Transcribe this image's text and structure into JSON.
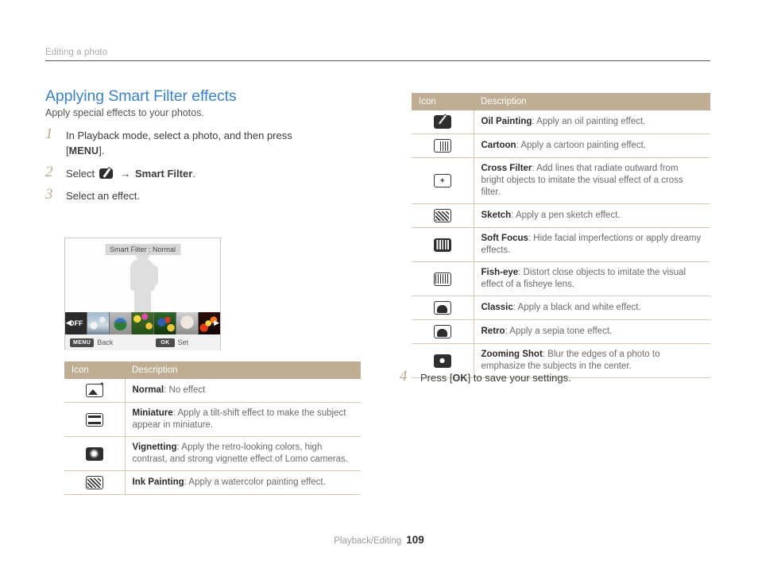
{
  "running_header": {
    "text": "Editing a photo"
  },
  "section": {
    "title": "Applying Smart Filter effects",
    "subtitle": "Apply special effects to your photos."
  },
  "steps": [
    {
      "num": "1",
      "text_before": "In Playback mode, select a photo, and then press",
      "bracket_open": "[",
      "key": "MENU",
      "bracket_close": "].",
      "text_after": ""
    },
    {
      "num": "2",
      "text_before": "Select",
      "icon": "edit-icon",
      "arrow": "→",
      "bold": "Smart Filter",
      "text_after": "."
    },
    {
      "num": "3",
      "text_before": "Select an effect.",
      "text_after": ""
    }
  ],
  "step4": {
    "num": "4",
    "text_before": "Press [",
    "key": "OK",
    "text_after": "] to save your settings."
  },
  "camera_screen": {
    "osd_label": "Smart Filter : Normal",
    "thumbnails": [
      {
        "label": "OFF",
        "kind": "off"
      },
      {
        "label": "",
        "kind": "sky"
      },
      {
        "label": "",
        "kind": "globe"
      },
      {
        "label": "",
        "kind": "flowers"
      },
      {
        "label": "",
        "kind": "parrot"
      },
      {
        "label": "",
        "kind": "face"
      },
      {
        "label": "",
        "kind": "fire"
      }
    ],
    "arrow_left": "◀",
    "arrow_right": "▶",
    "bottom_left_button": "MENU",
    "bottom_left_label": "Back",
    "bottom_right_button": "OK",
    "bottom_right_label": "Set"
  },
  "table_left": {
    "headers": {
      "icon": "Icon",
      "description": "Description"
    },
    "rows": [
      {
        "icon": "normal-icon",
        "name": "Normal",
        "desc": ": No effect"
      },
      {
        "icon": "miniature-icon",
        "name": "Miniature",
        "desc": ": Apply a tilt-shift effect to make the subject appear in miniature."
      },
      {
        "icon": "vignetting-icon",
        "name": "Vignetting",
        "desc": ": Apply the retro-looking colors, high contrast, and strong vignette effect of Lomo cameras."
      },
      {
        "icon": "ink-painting-icon",
        "name": "Ink Painting",
        "desc": ": Apply a watercolor painting effect."
      }
    ]
  },
  "table_right": {
    "headers": {
      "icon": "Icon",
      "description": "Description"
    },
    "rows": [
      {
        "icon": "oil-painting-icon",
        "name": "Oil Painting",
        "desc": ": Apply an oil painting effect."
      },
      {
        "icon": "cartoon-icon",
        "name": "Cartoon",
        "desc": ": Apply a cartoon painting effect."
      },
      {
        "icon": "cross-filter-icon",
        "name": "Cross Filter",
        "desc": ": Add lines that radiate outward from bright objects to imitate the visual effect of a cross filter."
      },
      {
        "icon": "sketch-icon",
        "name": "Sketch",
        "desc": ": Apply a pen sketch effect."
      },
      {
        "icon": "soft-focus-icon",
        "name": "Soft Focus",
        "desc": ": Hide facial imperfections or apply dreamy effects."
      },
      {
        "icon": "fish-eye-icon",
        "name": "Fish-eye",
        "desc": ": Distort close objects to imitate the visual effect of a fisheye lens."
      },
      {
        "icon": "classic-icon",
        "name": "Classic",
        "desc": ": Apply a black and white effect."
      },
      {
        "icon": "retro-icon",
        "name": "Retro",
        "desc": ": Apply a sepia tone effect."
      },
      {
        "icon": "zooming-shot-icon",
        "name": "Zooming Shot",
        "desc": ": Blur the edges of a photo to emphasize the subjects in the center."
      }
    ]
  },
  "footer": {
    "label": "Playback/Editing",
    "page_number": "109"
  },
  "colors": {
    "heading_blue": "#3b82c4",
    "table_header_tan": "#bfae94",
    "table_border": "#d6c9b4",
    "step_number": "#b9ab92",
    "body_text": "#3c3c3c",
    "muted_text": "#6b6b6b"
  }
}
